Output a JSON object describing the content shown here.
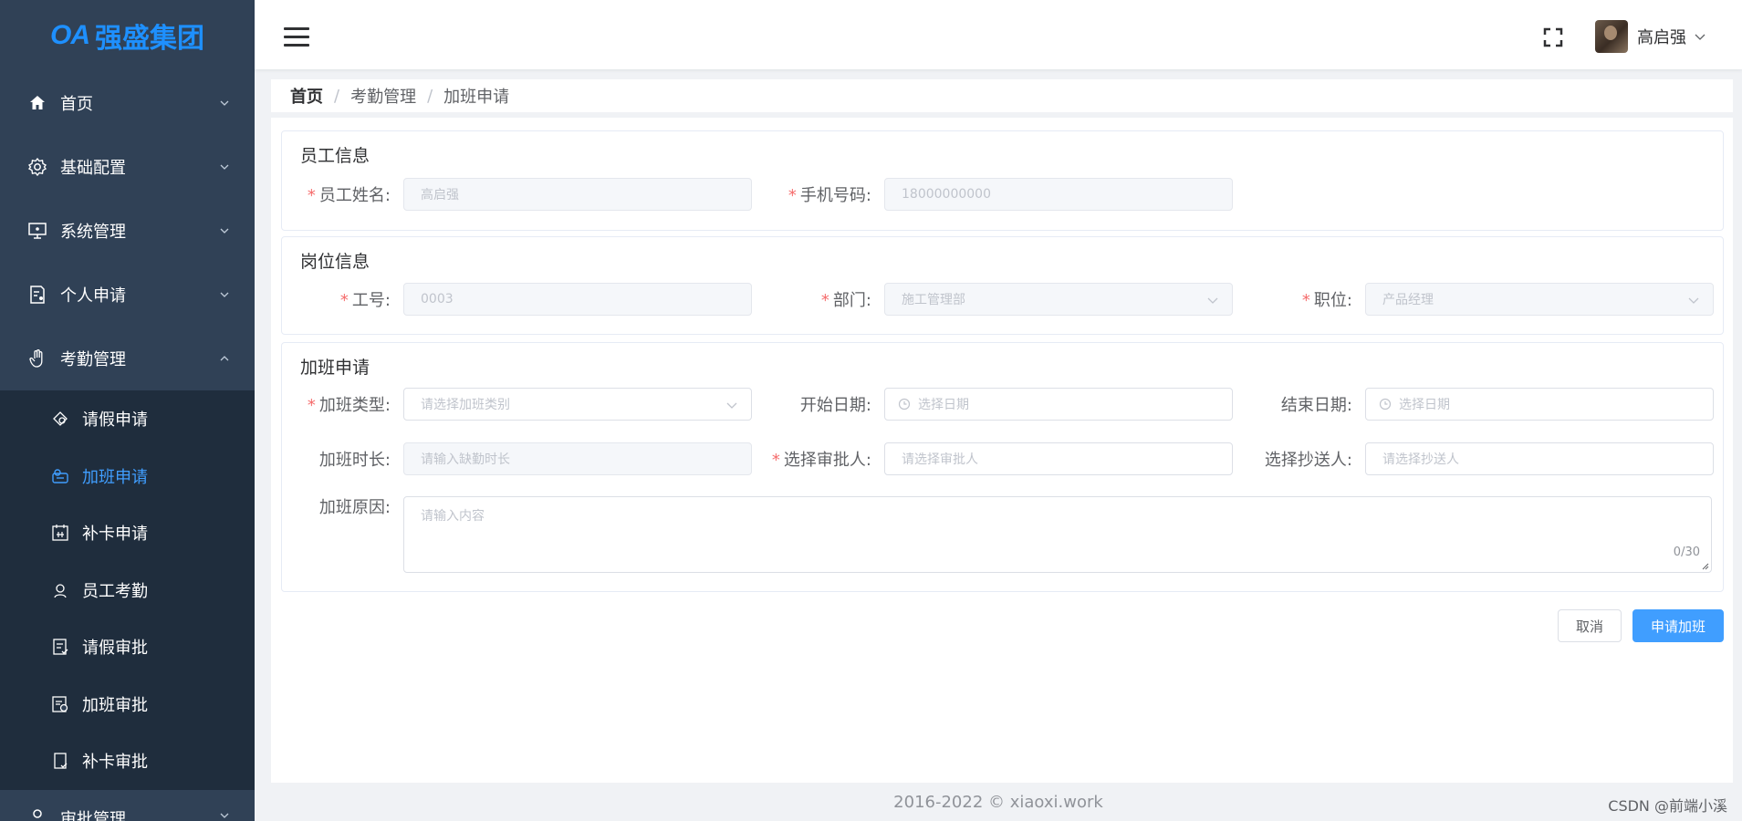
{
  "brand": {
    "oa": "OA",
    "name": "强盛集团",
    "color": "#1e90ff"
  },
  "sidebar": {
    "items": [
      {
        "label": "首页",
        "icon": "home-icon"
      },
      {
        "label": "基础配置",
        "icon": "gear-icon"
      },
      {
        "label": "系统管理",
        "icon": "monitor-icon"
      },
      {
        "label": "个人申请",
        "icon": "document-user-icon"
      },
      {
        "label": "考勤管理",
        "icon": "hand-icon",
        "expanded": true
      }
    ],
    "sub_items": [
      {
        "label": "请假申请",
        "icon": "leave-request-icon"
      },
      {
        "label": "加班申请",
        "icon": "overtime-request-icon",
        "active": true
      },
      {
        "label": "补卡申请",
        "icon": "calendar-card-icon"
      },
      {
        "label": "员工考勤",
        "icon": "person-icon"
      },
      {
        "label": "请假审批",
        "icon": "leave-approval-icon"
      },
      {
        "label": "加班审批",
        "icon": "overtime-approval-icon"
      },
      {
        "label": "补卡审批",
        "icon": "card-approval-icon"
      }
    ],
    "next_item": {
      "label": "审批管理",
      "icon": "approval-icon"
    },
    "bg_color": "#304156",
    "active_color": "#409eff"
  },
  "header": {
    "user_name": "高启强"
  },
  "breadcrumb": {
    "home": "首页",
    "separator": "/",
    "items": [
      "考勤管理",
      "加班申请"
    ]
  },
  "employee_info": {
    "title": "员工信息",
    "name_label": "员工姓名:",
    "name_value": "高启强",
    "phone_label": "手机号码:",
    "phone_value": "18000000000"
  },
  "position_info": {
    "title": "岗位信息",
    "id_label": "工号:",
    "id_value": "0003",
    "dept_label": "部门:",
    "dept_value": "施工管理部",
    "job_label": "职位:",
    "job_value": "产品经理"
  },
  "overtime": {
    "title": "加班申请",
    "type_label": "加班类型:",
    "type_placeholder": "请选择加班类别",
    "start_label": "开始日期:",
    "start_placeholder": "选择日期",
    "end_label": "结束日期:",
    "end_placeholder": "选择日期",
    "duration_label": "加班时长:",
    "duration_placeholder": "请输入缺勤时长",
    "approver_label": "选择审批人:",
    "approver_placeholder": "请选择审批人",
    "cc_label": "选择抄送人:",
    "cc_placeholder": "请选择抄送人",
    "reason_label": "加班原因:",
    "reason_placeholder": "请输入内容",
    "reason_counter": "0/30"
  },
  "actions": {
    "cancel_label": "取消",
    "submit_label": "申请加班",
    "primary_color": "#409eff"
  },
  "footer": {
    "copyright": "2016-2022 © xiaoxi.work",
    "watermark": "CSDN @前端小溪"
  }
}
